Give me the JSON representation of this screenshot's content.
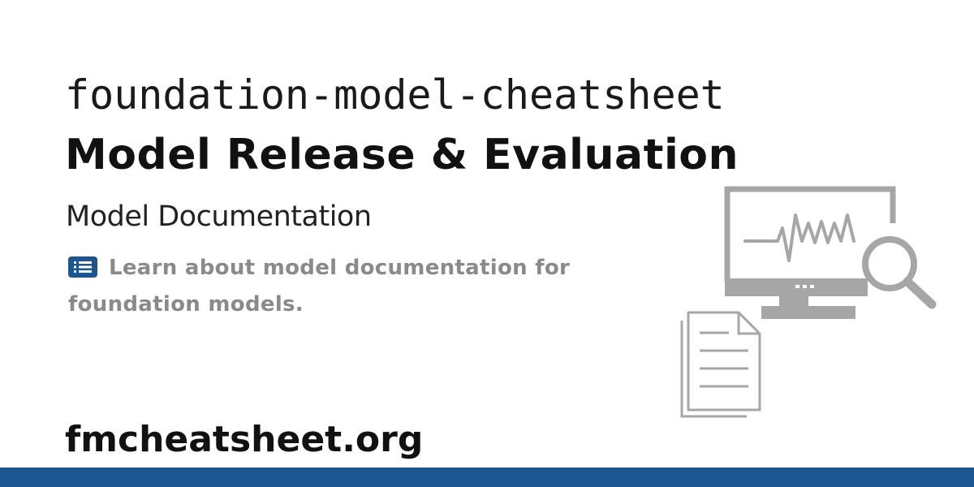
{
  "header": {
    "repo_name": "foundation-model-cheatsheet",
    "section_title": "Model Release & Evaluation",
    "subtitle": "Model Documentation"
  },
  "description": {
    "icon": "list-icon",
    "text": "Learn about model documentation for foundation models."
  },
  "footer": {
    "site": "fmcheatsheet.org"
  },
  "illustration": {
    "icons": [
      "monitor-pulse-icon",
      "magnifier-icon",
      "document-icon"
    ]
  },
  "colors": {
    "accent_bar": "#1c5590",
    "list_icon": "#1c5590",
    "illustration_gray": "#a6a6a6",
    "description_text": "#8a8a8a"
  }
}
